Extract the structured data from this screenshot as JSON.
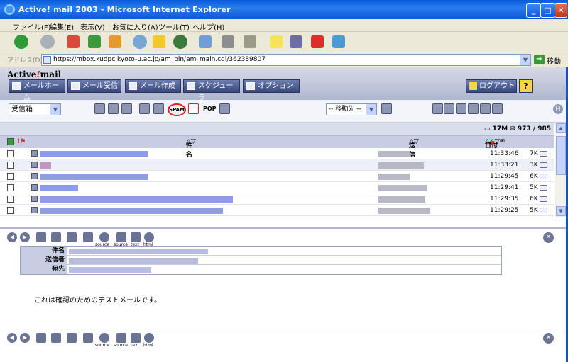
{
  "window": {
    "title": "Active! mail 2003 - Microsoft Internet Explorer",
    "buttons": [
      "_",
      "□",
      "✕"
    ]
  },
  "menu": [
    "ファイル(F)",
    "編集(E)",
    "表示(V)",
    "お気に入り(A)",
    "ツール(T)",
    "ヘルプ(H)"
  ],
  "address": {
    "label": "アドレス(D)",
    "url": "https://mbox.kudpc.kyoto-u.ac.jp/am_bin/am_main.cgi/362389807",
    "go": "移動"
  },
  "app": {
    "logo": {
      "main": "Active",
      "accent": "!",
      "suffix": "mail"
    },
    "nav": [
      "メールホーム",
      "メール受信",
      "メール作成",
      "スケジューラ",
      "オプション"
    ],
    "logout": "ログアウト",
    "help": "?"
  },
  "controls": {
    "folder": "受信箱",
    "moveto": "-- 移動先 --",
    "spam": "SPAM",
    "pop": "POP",
    "h": "H"
  },
  "list": {
    "quota": "17M",
    "count": "973 / 985",
    "headers": {
      "subject": "件名",
      "sender": "送信者",
      "date": "日付"
    },
    "rows": [
      {
        "time": "11:33:46",
        "size": "7K"
      },
      {
        "time": "11:33:21",
        "size": "3K"
      },
      {
        "time": "11:29:45",
        "size": "6K"
      },
      {
        "time": "11:29:41",
        "size": "5K"
      },
      {
        "time": "11:29:35",
        "size": "6K"
      },
      {
        "time": "11:29:25",
        "size": "5K"
      }
    ]
  },
  "toolbar_labels": [
    "source",
    "source",
    "text",
    "html"
  ],
  "message": {
    "fields": {
      "subject": "件名",
      "sender": "送信者",
      "to": "宛先"
    },
    "body": "これは確認のためのテストメールです。"
  }
}
